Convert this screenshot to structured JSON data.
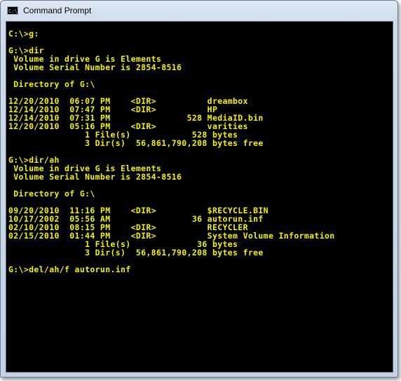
{
  "window": {
    "title": "Command Prompt",
    "icon": "cmd-app-icon"
  },
  "console": {
    "text_color": "#f2f200",
    "background": "#000000",
    "lines": [
      "C:\\>g:",
      "",
      "G:\\>dir",
      " Volume in drive G is Elements",
      " Volume Serial Number is 2854-8516",
      "",
      " Directory of G:\\",
      "",
      "12/20/2010  06:07 PM    <DIR>          dreambox",
      "12/14/2010  07:47 PM    <DIR>          HP",
      "12/14/2010  07:31 PM               528 MediaID.bin",
      "12/20/2010  05:16 PM    <DIR>          varities",
      "               1 File(s)            528 bytes",
      "               3 Dir(s)  56,861,790,208 bytes free",
      "",
      "G:\\>dir/ah",
      " Volume in drive G is Elements",
      " Volume Serial Number is 2854-8516",
      "",
      " Directory of G:\\",
      "",
      "09/20/2010  11:16 PM    <DIR>          $RECYCLE.BIN",
      "10/17/2002  05:56 AM                36 autorun.inf",
      "02/10/2010  08:15 PM    <DIR>          RECYCLER",
      "02/15/2010  01:44 PM    <DIR>          System Volume Information",
      "               1 File(s)             36 bytes",
      "               3 Dir(s)  56,861,790,208 bytes free",
      "",
      "G:\\>del/ah/f autorun.inf"
    ]
  }
}
